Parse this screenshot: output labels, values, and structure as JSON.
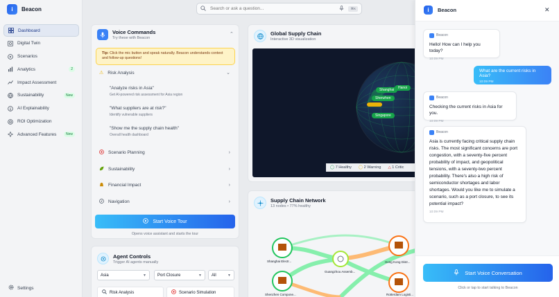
{
  "app": {
    "name": "Beacon"
  },
  "search": {
    "placeholder": "Search or ask a question...",
    "shortcut": "⌘K"
  },
  "sidebar": {
    "items": [
      {
        "label": "Dashboard",
        "icon": "dashboard-icon",
        "active": true
      },
      {
        "label": "Digital Twin",
        "icon": "twin-icon"
      },
      {
        "label": "Scenarios",
        "icon": "scenarios-icon"
      },
      {
        "label": "Analytics",
        "icon": "analytics-icon",
        "badge": "2"
      },
      {
        "label": "Impact Assessment",
        "icon": "impact-icon"
      },
      {
        "label": "Sustainability",
        "icon": "sustainability-icon",
        "badge": "New"
      },
      {
        "label": "AI Explainability",
        "icon": "ai-icon"
      },
      {
        "label": "ROI Optimization",
        "icon": "roi-icon"
      },
      {
        "label": "Advanced Features",
        "icon": "features-icon",
        "badge": "New"
      }
    ],
    "settings_label": "Settings"
  },
  "voice_panel": {
    "title": "Voice Commands",
    "subtitle": "Try these with Beacon",
    "tip_label": "Tip:",
    "tip_text": "Click the mic button and speak naturally. Beacon understands context and follow-up questions!",
    "sections": [
      {
        "label": "Risk Analysis",
        "icon": "warning-icon",
        "expanded": true
      },
      {
        "label": "Scenario Planning",
        "icon": "target-icon"
      },
      {
        "label": "Sustainability",
        "icon": "leaf-icon"
      },
      {
        "label": "Financial Impact",
        "icon": "money-icon"
      },
      {
        "label": "Navigation",
        "icon": "compass-icon"
      }
    ],
    "commands": [
      {
        "text": "\"Analyze risks in Asia\"",
        "desc": "Get AI-powered risk assessment for Asia region"
      },
      {
        "text": "\"What suppliers are at risk?\"",
        "desc": "Identify vulnerable suppliers"
      },
      {
        "text": "\"Show me the supply chain health\"",
        "desc": "Overall health dashboard"
      }
    ],
    "tour_button": "Start Voice Tour",
    "tour_note": "Opens voice assistant and starts the tour"
  },
  "agent_controls": {
    "title": "Agent Controls",
    "subtitle": "Trigger AI agents manually",
    "region": "Asia",
    "scenario": "Port Closure",
    "filter": "All",
    "buttons": [
      "Risk Analysis",
      "Scenario Simulation"
    ]
  },
  "global_supply_chain": {
    "title": "Global Supply Chain",
    "subtitle": "Interactive 3D visualization",
    "locations": [
      "Shanghai",
      "Shenzhen",
      "Singapore",
      "Hanoi"
    ],
    "status": {
      "healthy": "7 Healthy",
      "warning": "2 Warning",
      "critical": "1 Critic"
    }
  },
  "network": {
    "title": "Supply Chain Network",
    "subtitle": "13 nodes • 77% healthy",
    "nodes": [
      "Shanghai Electr...",
      "Guangzhou Assemb...",
      "Hong Kong Distr...",
      "Shenzhen Compone...",
      "Rotterdam Logisti..."
    ]
  },
  "chat": {
    "title": "Beacon",
    "sender": "Beacon",
    "messages": [
      {
        "from": "bot",
        "text": "Hello! How can I help you today?",
        "time": "10:09 PM"
      },
      {
        "from": "user",
        "text": "What are the current risks in Asia?",
        "time": "10:09 PM"
      },
      {
        "from": "bot",
        "text": "Checking the current risks in Asia for you.",
        "time": "10:09 PM"
      },
      {
        "from": "bot",
        "text": "Asia is currently facing critical supply chain risks. The most significant concerns are port congestion, with a seventy-five percent probability of impact, and geopolitical tensions, with a seventy-two percent probability. There's also a high risk of semiconductor shortages and labor shortages. Would you like me to simulate a scenario, such as a port closure, to see its potential impact?",
        "time": "10:09 PM"
      }
    ],
    "voice_button": "Start Voice Conversation",
    "voice_note": "Click or tap to start talking to Beacon"
  },
  "colors": {
    "accent": "#2563eb",
    "accent_light": "#38bdf8",
    "healthy": "#16a34a",
    "warning": "#eab308",
    "critical": "#dc2626"
  }
}
